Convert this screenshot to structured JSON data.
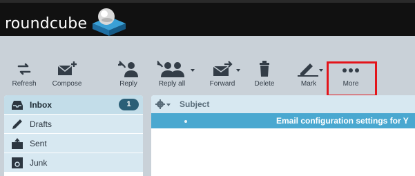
{
  "brand": {
    "name": "roundcube"
  },
  "toolbar": {
    "refresh": "Refresh",
    "compose": "Compose",
    "reply": "Reply",
    "reply_all": "Reply all",
    "forward": "Forward",
    "delete": "Delete",
    "mark": "Mark",
    "more": "More"
  },
  "folders": {
    "items": [
      {
        "label": "Inbox",
        "icon": "inbox-icon",
        "count": "1",
        "selected": true
      },
      {
        "label": "Drafts",
        "icon": "pencil-icon"
      },
      {
        "label": "Sent",
        "icon": "sent-icon"
      },
      {
        "label": "Junk",
        "icon": "junk-icon"
      }
    ]
  },
  "message_list": {
    "header_subject": "Subject",
    "rows": [
      {
        "subject": "Email configuration settings for Y",
        "selected": true
      }
    ]
  },
  "colors": {
    "header_bg": "#111111",
    "toolbar_bg": "#c9d1d8",
    "folder_bg": "#d7e8f1",
    "selected_row": "#4aa8d0",
    "badge_bg": "#2b5f77",
    "highlight_border": "#e3141a"
  }
}
